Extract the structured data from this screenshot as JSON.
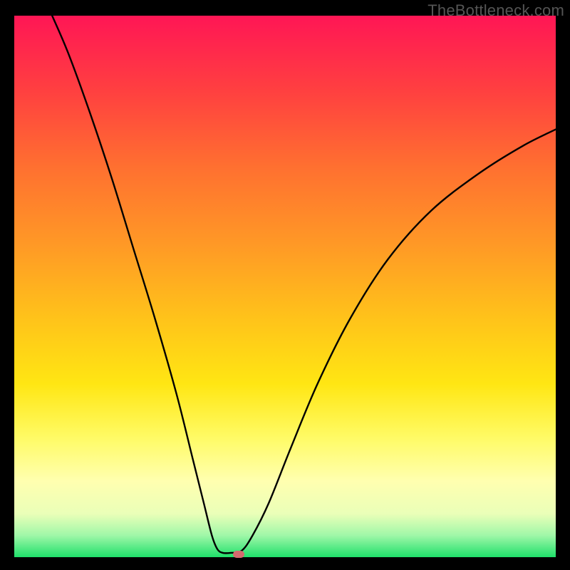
{
  "watermark": {
    "text": "TheBottleneck.com"
  },
  "chart_data": {
    "type": "line",
    "title": "",
    "xlabel": "",
    "ylabel": "",
    "xlim": [
      0,
      100
    ],
    "ylim": [
      0,
      100
    ],
    "grid": false,
    "legend": false,
    "series": [
      {
        "name": "curve",
        "color": "#000000",
        "points": [
          {
            "x": 7,
            "y": 100
          },
          {
            "x": 10,
            "y": 93
          },
          {
            "x": 14,
            "y": 82
          },
          {
            "x": 18,
            "y": 70
          },
          {
            "x": 22,
            "y": 57
          },
          {
            "x": 26,
            "y": 44
          },
          {
            "x": 30,
            "y": 30
          },
          {
            "x": 33,
            "y": 18
          },
          {
            "x": 35,
            "y": 10
          },
          {
            "x": 36.5,
            "y": 4
          },
          {
            "x": 37.5,
            "y": 1.5
          },
          {
            "x": 38.5,
            "y": 0.8
          },
          {
            "x": 40,
            "y": 0.8
          },
          {
            "x": 42,
            "y": 1.2
          },
          {
            "x": 44,
            "y": 4
          },
          {
            "x": 47,
            "y": 10
          },
          {
            "x": 51,
            "y": 20
          },
          {
            "x": 56,
            "y": 32
          },
          {
            "x": 62,
            "y": 44
          },
          {
            "x": 69,
            "y": 55
          },
          {
            "x": 77,
            "y": 64
          },
          {
            "x": 86,
            "y": 71
          },
          {
            "x": 94,
            "y": 76
          },
          {
            "x": 100,
            "y": 79
          }
        ]
      }
    ],
    "annotations": [
      {
        "type": "marker",
        "shape": "pill",
        "x": 41.5,
        "y": 0.5,
        "color": "#d56a6e"
      }
    ],
    "background_gradient": {
      "direction": "vertical",
      "stops": [
        {
          "pos": 0,
          "color": "#ff1655"
        },
        {
          "pos": 14,
          "color": "#ff4040"
        },
        {
          "pos": 28,
          "color": "#ff7030"
        },
        {
          "pos": 42,
          "color": "#ff9826"
        },
        {
          "pos": 56,
          "color": "#ffc31a"
        },
        {
          "pos": 68,
          "color": "#ffe613"
        },
        {
          "pos": 78,
          "color": "#fffb66"
        },
        {
          "pos": 86,
          "color": "#ffffb0"
        },
        {
          "pos": 92,
          "color": "#eaffb8"
        },
        {
          "pos": 96,
          "color": "#9ff7a8"
        },
        {
          "pos": 100,
          "color": "#1fe06a"
        }
      ]
    }
  }
}
